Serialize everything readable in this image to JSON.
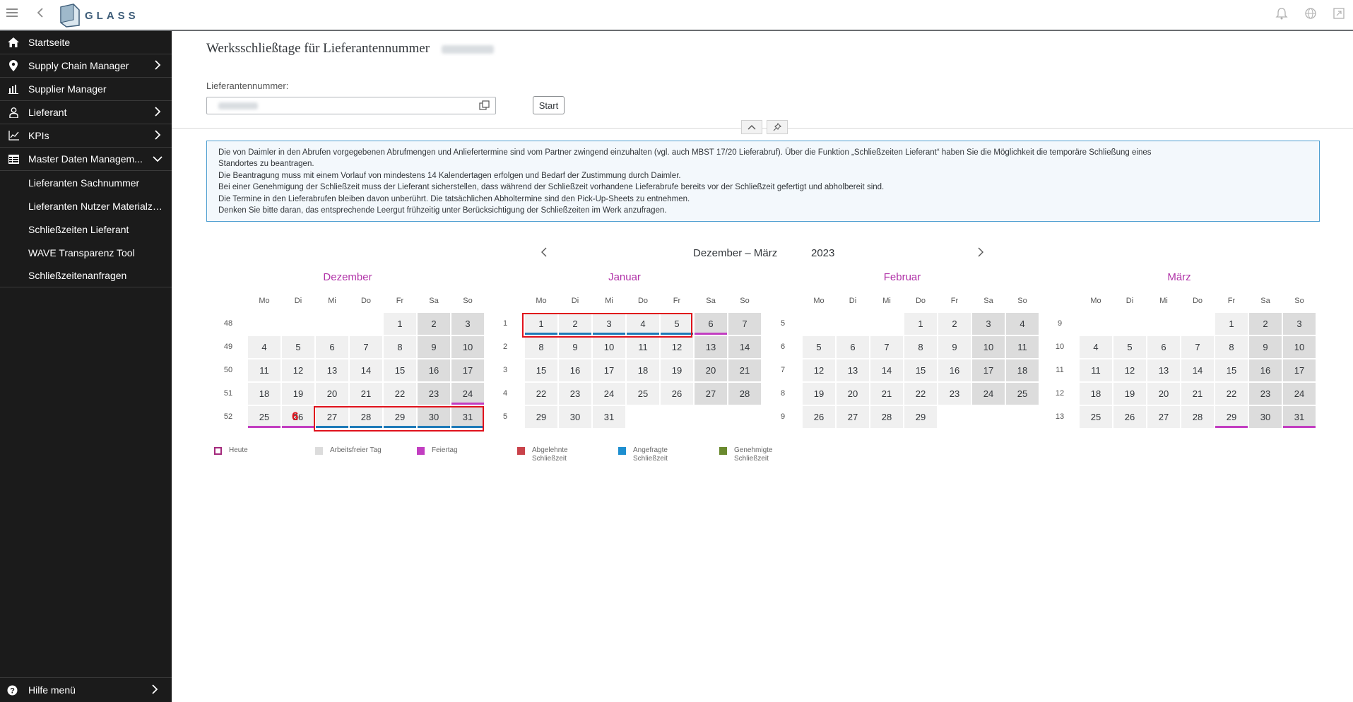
{
  "header": {
    "logo_text": "GLASS",
    "icons": [
      "menu-icon",
      "back-icon",
      "bell-icon",
      "globe-icon",
      "fullscreen-icon"
    ]
  },
  "sidebar": {
    "items": [
      {
        "label": "Startseite",
        "icon": "home-icon",
        "chevron": ""
      },
      {
        "label": "Supply Chain Manager",
        "icon": "location-pin-icon",
        "chevron": "right"
      },
      {
        "label": "Supplier Manager",
        "icon": "bar-chart-icon",
        "chevron": ""
      },
      {
        "label": "Lieferant",
        "icon": "person-icon",
        "chevron": "right"
      },
      {
        "label": "KPIs",
        "icon": "line-chart-icon",
        "chevron": "right"
      },
      {
        "label": "Master Daten Managem...",
        "icon": "table-icon",
        "chevron": "down"
      }
    ],
    "subitems": [
      {
        "label": "Lieferanten Sachnummer"
      },
      {
        "label": "Lieferanten Nutzer Materialzu..."
      },
      {
        "label": "Schließzeiten Lieferant"
      },
      {
        "label": "WAVE Transparenz Tool"
      },
      {
        "label": "Schließzeitenanfragen"
      }
    ],
    "help": {
      "label": "Hilfe menü",
      "icon": "help-icon"
    }
  },
  "main": {
    "title": "Werksschließtage für Lieferantennummer",
    "field_label": "Lieferantennummer:",
    "start_label": "Start",
    "info_lines": [
      "Die von Daimler in den Abrufen vorgegebenen Abrufmengen und Anliefertermine sind vom Partner zwingend einzuhalten (vgl. auch MBST 17/20 Lieferabruf). Über die Funktion „Schließzeiten Lieferant“ haben Sie die Möglichkeit die temporäre Schließung eines",
      "Standortes zu beantragen.",
      "Die Beantragung muss mit einem Vorlauf von mindestens 14 Kalendertagen erfolgen und Bedarf der Zustimmung durch Daimler.",
      "Bei einer Genehmigung der Schließzeit muss der Lieferant sicherstellen, dass während der Schließzeit vorhandene Lieferabrufe bereits vor der Schließzeit gefertigt und abholbereit sind.",
      "Die Termine in den Lieferabrufen bleiben davon unberührt. Die tatsächlichen Abholtermine sind den Pick-Up-Sheets zu entnehmen.",
      "Denken Sie bitte daran, das entsprechende Leergut frühzeitig unter Berücksichtigung der Schließzeiten im Werk anzufragen."
    ]
  },
  "calendar": {
    "range_label": "Dezember – März",
    "year": "2023",
    "weekdays": [
      "Mo",
      "Di",
      "Mi",
      "Do",
      "Fr",
      "Sa",
      "So"
    ],
    "badge": "6",
    "months": [
      {
        "name": "Dezember",
        "weeks": [
          {
            "kw": "48",
            "days": [
              "",
              "",
              "",
              "",
              "1",
              "2",
              "3"
            ]
          },
          {
            "kw": "49",
            "days": [
              "4",
              "5",
              "6",
              "7",
              "8",
              "9",
              "10"
            ]
          },
          {
            "kw": "50",
            "days": [
              "11",
              "12",
              "13",
              "14",
              "15",
              "16",
              "17"
            ]
          },
          {
            "kw": "51",
            "days": [
              "18",
              "19",
              "20",
              "21",
              "22",
              "23",
              "24"
            ]
          },
          {
            "kw": "52",
            "days": [
              "25",
              "26",
              "27",
              "28",
              "29",
              "30",
              "31"
            ]
          }
        ],
        "holidays": [
          "24",
          "25",
          "26"
        ],
        "requested": [
          "27",
          "28",
          "29",
          "30",
          "31"
        ]
      },
      {
        "name": "Januar",
        "weeks": [
          {
            "kw": "1",
            "days": [
              "1",
              "2",
              "3",
              "4",
              "5",
              "6",
              "7"
            ]
          },
          {
            "kw": "2",
            "days": [
              "8",
              "9",
              "10",
              "11",
              "12",
              "13",
              "14"
            ]
          },
          {
            "kw": "3",
            "days": [
              "15",
              "16",
              "17",
              "18",
              "19",
              "20",
              "21"
            ]
          },
          {
            "kw": "4",
            "days": [
              "22",
              "23",
              "24",
              "25",
              "26",
              "27",
              "28"
            ]
          },
          {
            "kw": "5",
            "days": [
              "29",
              "30",
              "31",
              "",
              "",
              "",
              ""
            ]
          }
        ],
        "holidays": [
          "6"
        ],
        "requested": [
          "1",
          "2",
          "3",
          "4",
          "5"
        ]
      },
      {
        "name": "Februar",
        "weeks": [
          {
            "kw": "5",
            "days": [
              "",
              "",
              "",
              "1",
              "2",
              "3",
              "4"
            ]
          },
          {
            "kw": "6",
            "days": [
              "5",
              "6",
              "7",
              "8",
              "9",
              "10",
              "11"
            ]
          },
          {
            "kw": "7",
            "days": [
              "12",
              "13",
              "14",
              "15",
              "16",
              "17",
              "18"
            ]
          },
          {
            "kw": "8",
            "days": [
              "19",
              "20",
              "21",
              "22",
              "23",
              "24",
              "25"
            ]
          },
          {
            "kw": "9",
            "days": [
              "26",
              "27",
              "28",
              "29",
              "",
              "",
              ""
            ]
          }
        ],
        "holidays": [],
        "requested": []
      },
      {
        "name": "März",
        "weeks": [
          {
            "kw": "9",
            "days": [
              "",
              "",
              "",
              "",
              "1",
              "2",
              "3"
            ]
          },
          {
            "kw": "10",
            "days": [
              "4",
              "5",
              "6",
              "7",
              "8",
              "9",
              "10"
            ]
          },
          {
            "kw": "11",
            "days": [
              "11",
              "12",
              "13",
              "14",
              "15",
              "16",
              "17"
            ]
          },
          {
            "kw": "12",
            "days": [
              "18",
              "19",
              "20",
              "21",
              "22",
              "23",
              "24"
            ]
          },
          {
            "kw": "13",
            "days": [
              "25",
              "26",
              "27",
              "28",
              "29",
              "30",
              "31"
            ]
          }
        ],
        "holidays": [
          "29",
          "31"
        ],
        "requested": []
      }
    ]
  },
  "legend": [
    {
      "label": "Heute",
      "color": "#a4297c",
      "style": "outline"
    },
    {
      "label": "Arbeitsfreier Tag",
      "color": "#dcdcdc",
      "style": "fill"
    },
    {
      "label": "Feiertag",
      "color": "#c23ec1",
      "style": "fill"
    },
    {
      "label": "Abgelehnte Schließzeit",
      "color": "#c9424a",
      "style": "fill"
    },
    {
      "label": "Angefragte Schließzeit",
      "color": "#1e8fd0",
      "style": "fill"
    },
    {
      "label": "Genehmigte Schließzeit",
      "color": "#6a8a2e",
      "style": "fill"
    }
  ]
}
